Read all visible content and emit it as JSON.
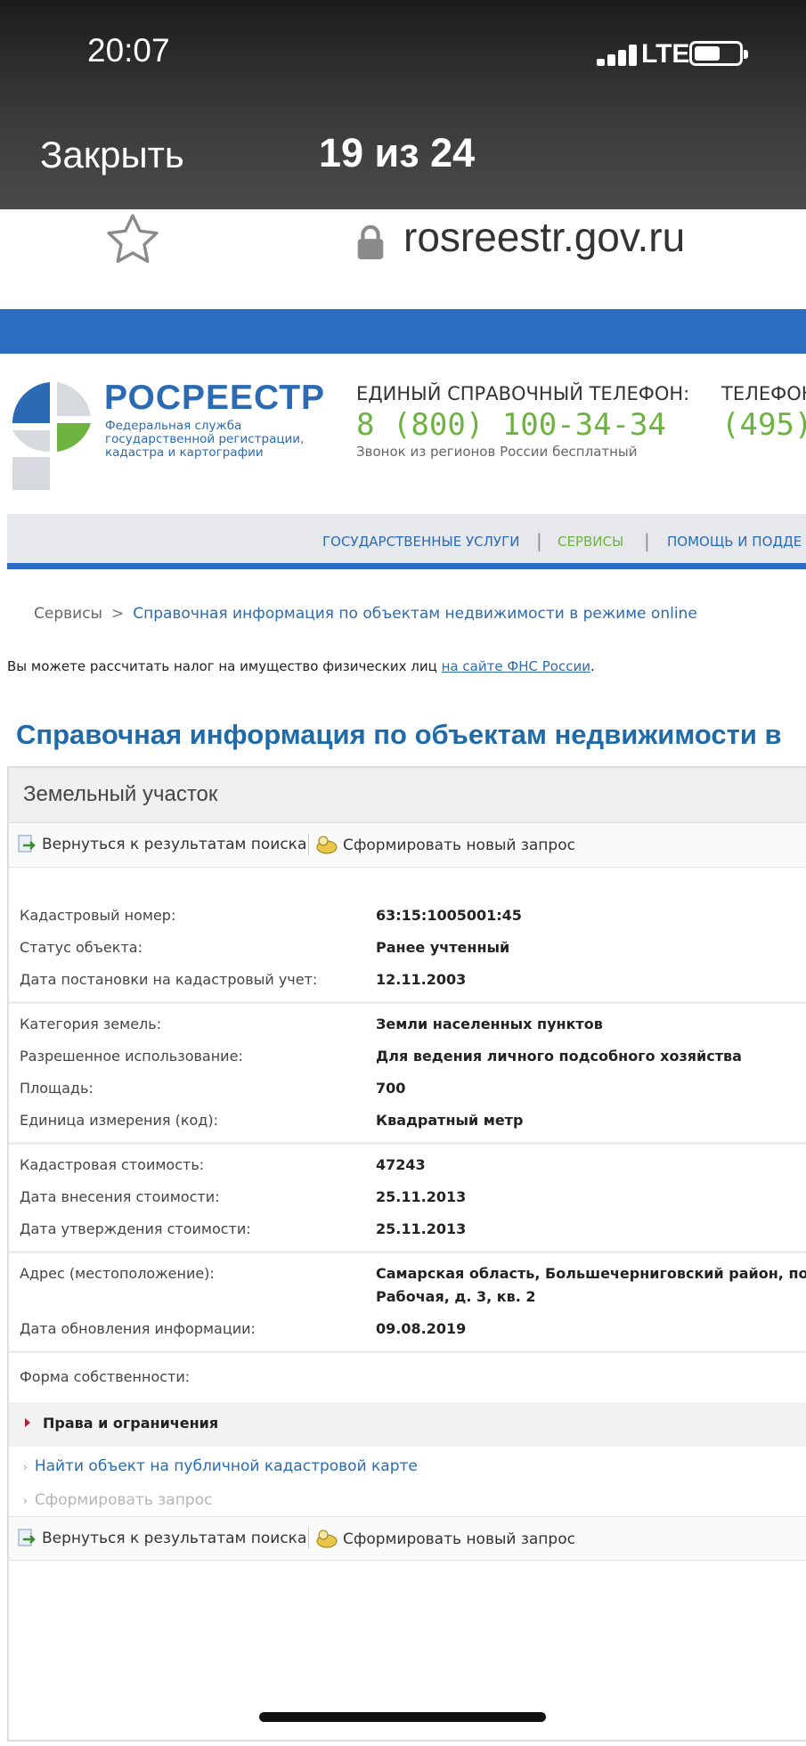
{
  "status_bar": {
    "time": "20:07",
    "network": "LTE"
  },
  "viewer": {
    "close_label": "Закрыть",
    "counter": "19 из 24"
  },
  "browser": {
    "url": "rosreestr.gov.ru"
  },
  "header": {
    "brand": "РОСРЕЕСТР",
    "brand_sub_1": "Федеральная служба",
    "brand_sub_2": "государственной регистрации,",
    "brand_sub_3": "кадастра и картографии",
    "phone_label": "ЕДИНЫЙ СПРАВОЧНЫЙ ТЕЛЕФОН:",
    "phone_number": "8 (800) 100-34-34",
    "phone_note": "Звонок из регионов России бесплатный",
    "phone2_label": "ТЕЛЕФОН",
    "phone2_number": "(495)"
  },
  "nav": {
    "items": [
      {
        "label": "ГОСУДАРСТВЕННЫЕ УСЛУГИ",
        "color": "#2a6bb3"
      },
      {
        "label": "СЕРВИСЫ",
        "color": "#6cb33f"
      },
      {
        "label": "ПОМОЩЬ И ПОДДЕ",
        "color": "#2a6bb3"
      }
    ],
    "separator": "|"
  },
  "breadcrumb": {
    "root": "Сервисы",
    "arrow": ">",
    "current": "Справочная информация по объектам недвижимости в режиме online"
  },
  "tax_note": {
    "text": "Вы можете рассчитать налог на имущество физических лиц ",
    "link": "на сайте ФНС России",
    "tail": "."
  },
  "page_title": "Справочная информация по объектам недвижимости в",
  "panel": {
    "title": "Земельный участок",
    "toolbar": {
      "back_label": "Вернуться к результатам поиска",
      "new_label": "Сформировать новый запрос"
    },
    "groups": [
      [
        {
          "label": "Кадастровый номер:",
          "value": "63:15:1005001:45"
        },
        {
          "label": "Статус объекта:",
          "value": "Ранее учтенный"
        },
        {
          "label": "Дата постановки на кадастровый учет:",
          "value": "12.11.2003"
        }
      ],
      [
        {
          "label": "Категория земель:",
          "value": "Земли населенных пунктов"
        },
        {
          "label": "Разрешенное использование:",
          "value": "Для ведения личного подсобного хозяйства"
        },
        {
          "label": "Площадь:",
          "value": "700"
        },
        {
          "label": "Единица измерения (код):",
          "value": "Квадратный метр"
        }
      ],
      [
        {
          "label": "Кадастровая стоимость:",
          "value": "47243"
        },
        {
          "label": "Дата внесения стоимости:",
          "value": "25.11.2013"
        },
        {
          "label": "Дата утверждения стоимости:",
          "value": "25.11.2013"
        }
      ]
    ],
    "address": {
      "label": "Адрес (местоположение):",
      "value_line1": "Самарская область, Большечерниговский район, посело",
      "value_line2": "Рабочая, д. 3, кв. 2"
    },
    "updated": {
      "label": "Дата обновления информации:",
      "value": "09.08.2019"
    },
    "ownership": {
      "label": "Форма собственности:",
      "value": ""
    },
    "rights_label": "Права и ограничения",
    "links": [
      {
        "label": "Найти объект на публичной кадастровой карте",
        "color": "#2a6bb3"
      },
      {
        "label": "Сформировать запрос",
        "color": "#b5b5b5"
      }
    ],
    "chevron": "›"
  },
  "colors": {
    "brand_blue": "#2a6bb3",
    "band_blue": "#2c6cc1",
    "accent_green": "#6cb33f",
    "rights_marker": "#b0203a"
  }
}
